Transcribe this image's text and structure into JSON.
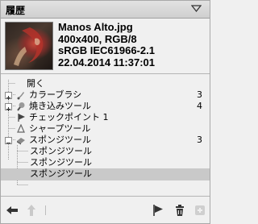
{
  "panel": {
    "title": "履歴"
  },
  "image_info": {
    "filename": "Manos Alto.jpg",
    "dimensions": "400x400, RGB/8",
    "color_profile": "sRGB IEC61966-2.1",
    "datetime": "22.04.2014 11:37:01"
  },
  "history": {
    "items": [
      {
        "label": "開く",
        "count": "",
        "icon": "open"
      },
      {
        "label": "カラーブラシ",
        "count": "3",
        "icon": "color-brush-icon"
      },
      {
        "label": "焼き込みツール",
        "count": "4",
        "icon": "burn-tool-icon"
      },
      {
        "label": "チェックポイント 1",
        "count": "",
        "icon": "checkpoint-flag-icon"
      },
      {
        "label": "シャープツール",
        "count": "",
        "icon": "sharpen-tool-icon"
      },
      {
        "label": "スポンジツール",
        "count": "3",
        "icon": "sponge-tool-icon"
      },
      {
        "label": "スポンジツール",
        "count": ""
      },
      {
        "label": "スポンジツール",
        "count": ""
      },
      {
        "label": "スポンジツール",
        "count": ""
      }
    ],
    "selected_index": 8
  },
  "toolbar": {
    "icons": [
      "undo-arrow-icon",
      "redo-arrow-icon",
      "add-checkpoint-icon",
      "delete-icon",
      "settings-icon"
    ]
  },
  "colors": {
    "selection": "#c9c9c9",
    "panel_bg": "#f0f0f0",
    "header_bg": "#d8d8d8"
  }
}
